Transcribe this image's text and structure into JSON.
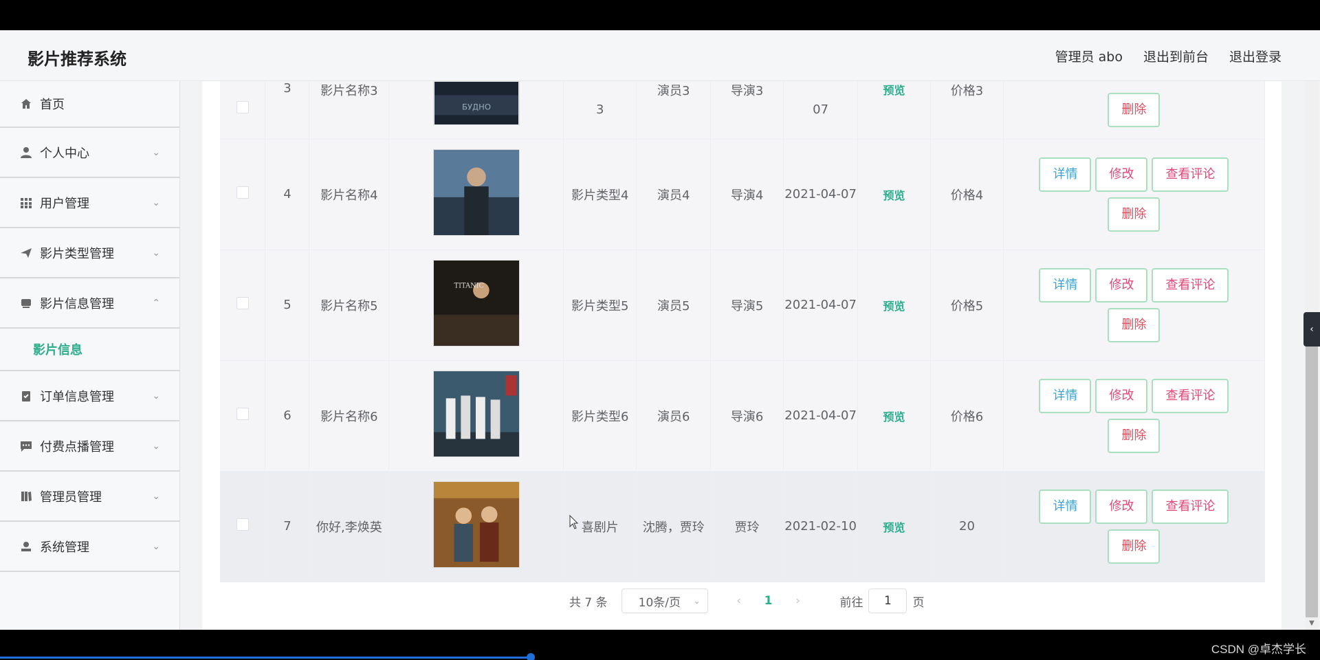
{
  "header": {
    "brand": "影片推荐系统",
    "admin": "管理员 abo",
    "back_front": "退出到前台",
    "logout": "退出登录"
  },
  "sidebar": {
    "items": [
      {
        "label": "首页",
        "icon": "home-icon"
      },
      {
        "label": "个人中心",
        "icon": "user-icon"
      },
      {
        "label": "用户管理",
        "icon": "grid-icon"
      },
      {
        "label": "影片类型管理",
        "icon": "send-icon"
      },
      {
        "label": "影片信息管理",
        "icon": "film-icon"
      },
      {
        "label": "订单信息管理",
        "icon": "clipboard-icon"
      },
      {
        "label": "付费点播管理",
        "icon": "chat-icon"
      },
      {
        "label": "管理员管理",
        "icon": "book-icon"
      },
      {
        "label": "系统管理",
        "icon": "person-icon"
      }
    ],
    "sub_active": "影片信息"
  },
  "table": {
    "rows": [
      {
        "index": "3",
        "name": "影片名称3",
        "type": "3",
        "actor": "演员3",
        "director": "导演3",
        "date": "07",
        "preview": "预览",
        "price": "价格3"
      },
      {
        "index": "4",
        "name": "影片名称4",
        "type": "影片类型4",
        "actor": "演员4",
        "director": "导演4",
        "date": "2021-04-07",
        "preview": "预览",
        "price": "价格4"
      },
      {
        "index": "5",
        "name": "影片名称5",
        "type": "影片类型5",
        "actor": "演员5",
        "director": "导演5",
        "date": "2021-04-07",
        "preview": "预览",
        "price": "价格5"
      },
      {
        "index": "6",
        "name": "影片名称6",
        "type": "影片类型6",
        "actor": "演员6",
        "director": "导演6",
        "date": "2021-04-07",
        "preview": "预览",
        "price": "价格6"
      },
      {
        "index": "7",
        "name": "你好,李焕英",
        "type": "喜剧片",
        "actor": "沈腾，贾玲",
        "director": "贾玲",
        "date": "2021-02-10",
        "preview": "预览",
        "price": "20"
      }
    ],
    "buttons": {
      "detail": "详情",
      "edit": "修改",
      "comments": "查看评论",
      "delete": "删除"
    }
  },
  "pagination": {
    "total": "共 7 条",
    "page_size": "10条/页",
    "current_page": "1",
    "goto_label": "前往",
    "goto_value": "1",
    "goto_unit": "页"
  },
  "watermark": "CSDN @卓杰学长",
  "colors": {
    "accent": "#2cae8c",
    "danger": "#e04a7a"
  }
}
